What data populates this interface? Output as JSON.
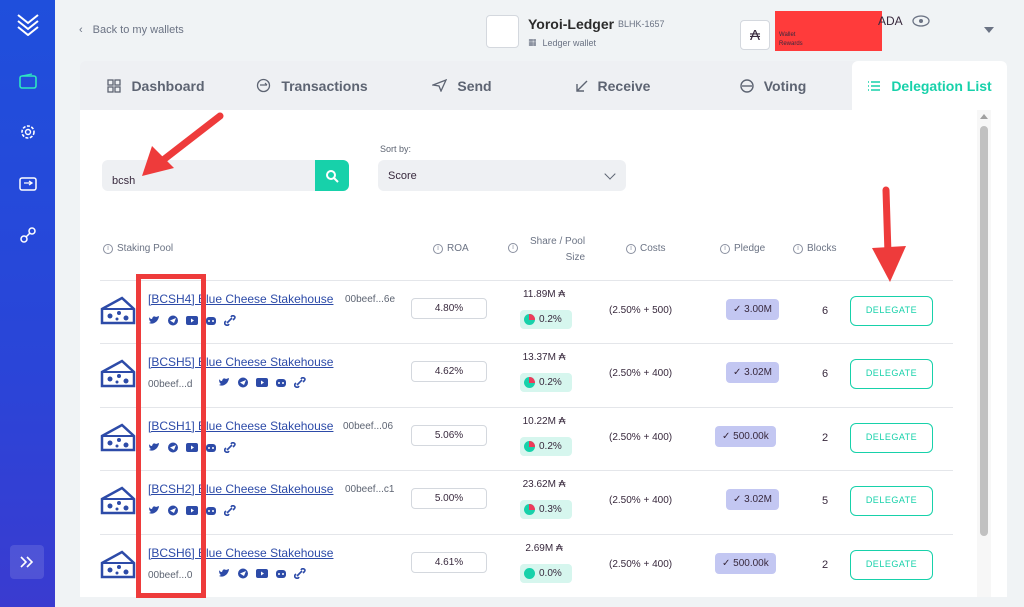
{
  "sidebar": {
    "items": [
      "wallet-icon",
      "settings-icon",
      "transfer-icon",
      "staking-icon"
    ],
    "expand_icon": "double-chevron-right-icon"
  },
  "header": {
    "back_label": "Back to my wallets",
    "wallet_name": "Yoroi-Ledger",
    "wallet_id": "BLHK-1657",
    "wallet_type": "Ledger wallet",
    "ada_symbol": "₳",
    "wallet_label": "Wallet",
    "rewards_label": "Rewards",
    "currency": "ADA"
  },
  "tabs": [
    {
      "label": "Dashboard",
      "icon": "dashboard-icon"
    },
    {
      "label": "Transactions",
      "icon": "transactions-icon"
    },
    {
      "label": "Send",
      "icon": "send-icon"
    },
    {
      "label": "Receive",
      "icon": "receive-icon"
    },
    {
      "label": "Voting",
      "icon": "voting-icon"
    },
    {
      "label": "Delegation List",
      "icon": "list-icon",
      "active": true
    }
  ],
  "search": {
    "value": "bcsh"
  },
  "sort": {
    "label": "Sort by:",
    "value": "Score"
  },
  "columns": {
    "pool": "Staking Pool",
    "roa": "ROA",
    "share_line1": "Share / Pool",
    "share_line2": "Size",
    "costs": "Costs",
    "pledge": "Pledge",
    "blocks": "Blocks"
  },
  "rows": [
    {
      "name": "[BCSH4] Blue Cheese Stakehouse",
      "hash": "00beef...6e",
      "roa": "4.80%",
      "size": "11.89M ₳",
      "share": "0.2%",
      "costs": "(2.50% + 500)",
      "pledge": "✓ 3.00M",
      "blocks": "6",
      "action": "DELEGATE"
    },
    {
      "name": "[BCSH5] Blue Cheese Stakehouse",
      "hash": "00beef...d",
      "roa": "4.62%",
      "size": "13.37M ₳",
      "share": "0.2%",
      "costs": "(2.50% + 400)",
      "pledge": "✓ 3.02M",
      "blocks": "6",
      "action": "DELEGATE"
    },
    {
      "name": "[BCSH1] Blue Cheese Stakehouse",
      "hash": "00beef...06",
      "roa": "5.06%",
      "size": "10.22M ₳",
      "share": "0.2%",
      "costs": "(2.50% + 400)",
      "pledge": "✓ 500.00k",
      "blocks": "2",
      "action": "DELEGATE"
    },
    {
      "name": "[BCSH2] Blue Cheese Stakehouse",
      "hash": "00beef...c1",
      "roa": "5.00%",
      "size": "23.62M ₳",
      "share": "0.3%",
      "costs": "(2.50% + 400)",
      "pledge": "✓ 3.02M",
      "blocks": "5",
      "action": "DELEGATE"
    },
    {
      "name": "[BCSH6] Blue Cheese Stakehouse",
      "hash": "00beef...0",
      "roa": "4.61%",
      "size": "2.69M ₳",
      "share": "0.0%",
      "costs": "(2.50% + 400)",
      "pledge": "✓ 500.00k",
      "blocks": "2",
      "action": "DELEGATE"
    }
  ],
  "colors": {
    "accent": "#17d1aa",
    "sidebar": "#2a45d8",
    "annotation": "#ee3b3b"
  }
}
